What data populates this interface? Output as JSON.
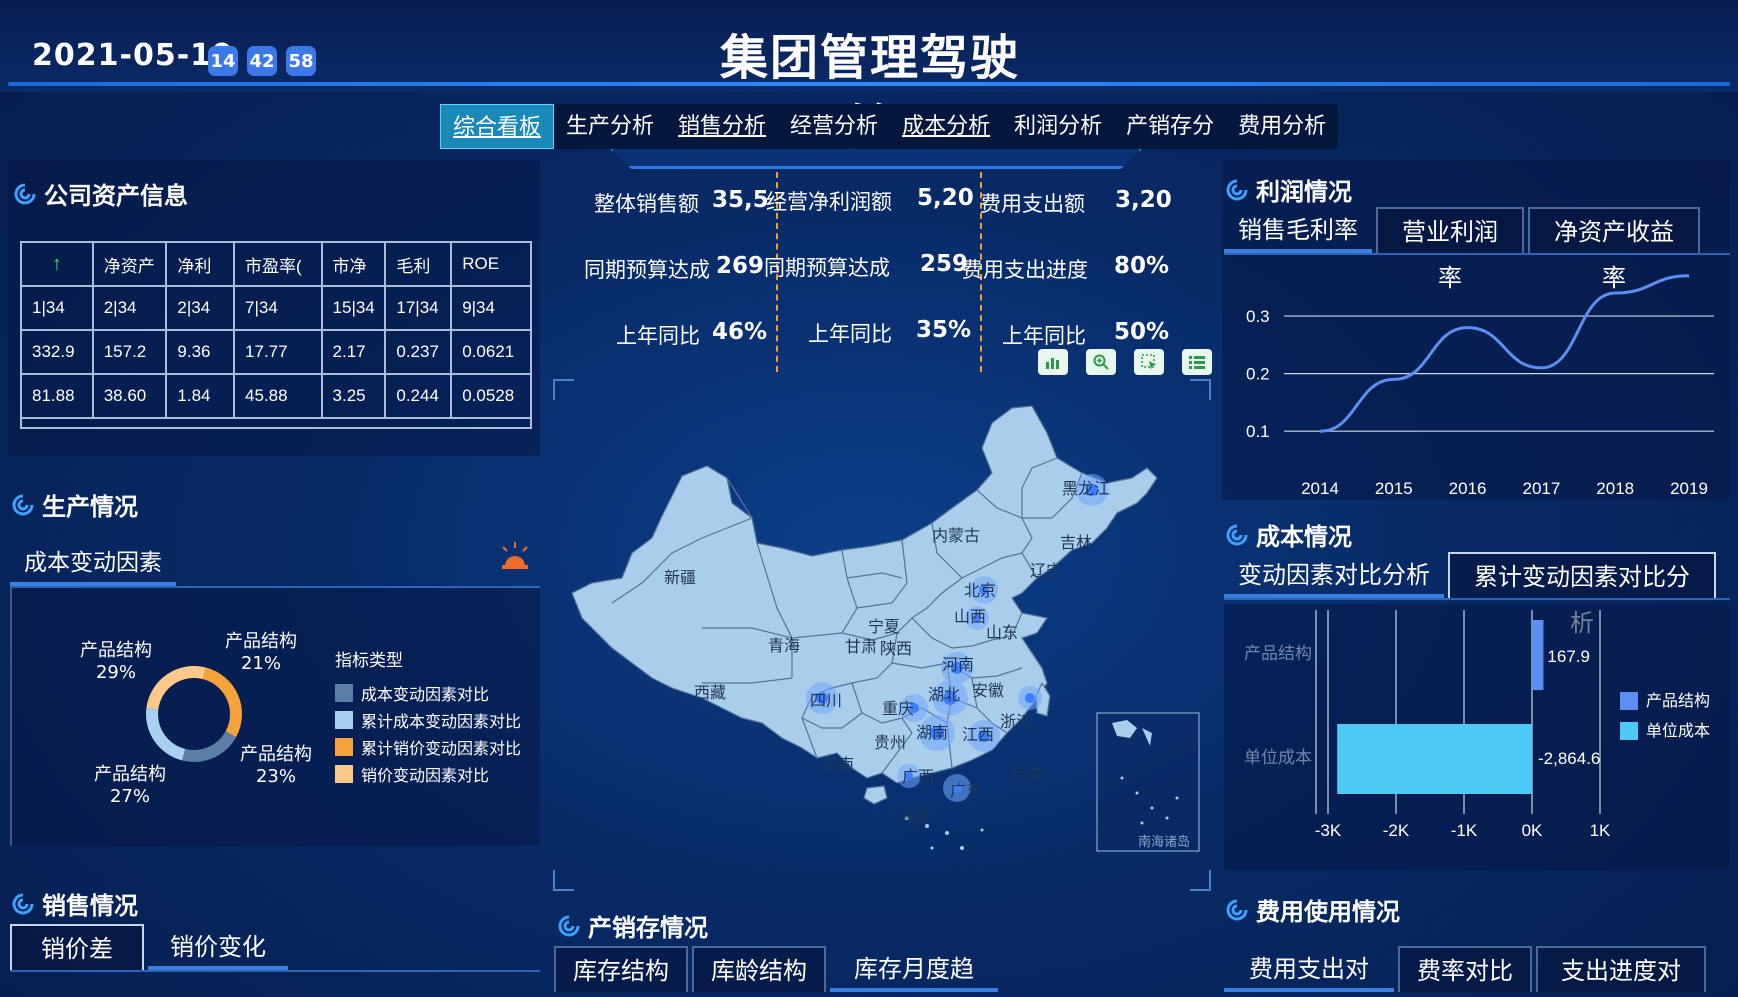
{
  "header": {
    "date": "2021-05-19",
    "time": [
      "14",
      "42",
      "58"
    ],
    "title": "集团管理驾驶舱"
  },
  "nav": {
    "tabs": [
      {
        "label": "综合看板",
        "active": true
      },
      {
        "label": "生产分析"
      },
      {
        "label": "销售分析"
      },
      {
        "label": "经营分析"
      },
      {
        "label": "成本分析"
      },
      {
        "label": "利润分析"
      },
      {
        "label": "产销存分"
      },
      {
        "label": "费用分析"
      }
    ]
  },
  "assets": {
    "title": "公司资产信息",
    "header_arrow": "↑",
    "columns": [
      "净资产",
      "净利",
      "市盈率(",
      "市净",
      "毛利",
      "ROE"
    ],
    "rows": [
      [
        "1|34",
        "2|34",
        "2|34",
        "7|34",
        "15|34",
        "17|34",
        "9|34"
      ],
      [
        "332.9",
        "157.2",
        "9.36",
        "17.77",
        "2.17",
        "0.237",
        "0.0621"
      ],
      [
        "81.88",
        "38.60",
        "1.84",
        "45.88",
        "3.25",
        "0.244",
        "0.0528"
      ]
    ]
  },
  "production": {
    "title": "生产情况",
    "tab": "成本变动因素",
    "donut_labels": [
      {
        "name": "产品结构",
        "pct": "29%"
      },
      {
        "name": "产品结构",
        "pct": "21%"
      },
      {
        "name": "产品结构",
        "pct": "23%"
      },
      {
        "name": "产品结构",
        "pct": "27%"
      }
    ],
    "legend_title": "指标类型",
    "legend": [
      {
        "label": "成本变动因素对比",
        "color": "#5a7ea6"
      },
      {
        "label": "累计成本变动因素对比",
        "color": "#a8d0f0"
      },
      {
        "label": "累计销价变动因素对比",
        "color": "#f5a23a"
      },
      {
        "label": "销价变动因素对比",
        "color": "#fcc98a"
      }
    ]
  },
  "sales": {
    "title": "销售情况",
    "tabs": [
      "销价差",
      "销价变化"
    ]
  },
  "kpi": {
    "row1": [
      {
        "label": "整体销售额",
        "value": "35,5"
      },
      {
        "label": "经营净利润额",
        "value": "5,20"
      },
      {
        "label": "费用支出额",
        "value": "3,20"
      }
    ],
    "row2": [
      {
        "label": "同期预算达成",
        "value": "269"
      },
      {
        "label": "同期预算达成",
        "value": "259"
      },
      {
        "label": "费用支出进度",
        "value": "80%"
      }
    ],
    "row3": [
      {
        "label": "上年同比",
        "value": "46%"
      },
      {
        "label": "上年同比",
        "value": "35%"
      },
      {
        "label": "上年同比",
        "value": "50%"
      }
    ]
  },
  "map": {
    "provinces": {
      "xinjiang": "新疆",
      "xizang": "西藏",
      "qinghai": "青海",
      "gansu": "甘肃",
      "neimenggu": "内蒙古",
      "heilongjiang": "黑龙江",
      "jilin": "吉林",
      "liaoning": "辽宁",
      "ningxia": "宁夏",
      "shaanxi": "陕西",
      "shandong": "山东",
      "sichuan": "四川",
      "chongqing": "重庆",
      "guizhou": "贵州",
      "yunnan": "云南",
      "guangxi": "广西",
      "anhui": "安徽",
      "zhejiang": "浙江",
      "taiwan": "台湾",
      "hainan": "海南",
      "hebei": "北京",
      "henan": "河南",
      "hubei": "湖北",
      "hunan": "湖南",
      "jiangxi": "江西",
      "guangdong": "广东",
      "shanxi": "山西"
    },
    "inset_label": "南海诸岛"
  },
  "inventory": {
    "title": "产销存情况",
    "tabs": [
      "库存结构",
      "库龄结构",
      "库存月度趋势"
    ]
  },
  "profit": {
    "title": "利润情况",
    "tabs": [
      "销售毛利率",
      "营业利润率",
      "净资产收益率"
    ]
  },
  "cost": {
    "title": "成本情况",
    "tabs": [
      "变动因素对比分析",
      "累计变动因素对比分析"
    ]
  },
  "expense": {
    "title": "费用使用情况",
    "tabs": [
      "费用支出对比",
      "费率对比",
      "支出进度对比"
    ]
  },
  "chart_data": [
    {
      "type": "line",
      "x": [
        "2014",
        "2015",
        "2016",
        "2017",
        "2018",
        "2019"
      ],
      "series": [
        {
          "values": [
            0.1,
            0.19,
            0.28,
            0.21,
            0.34,
            0.37
          ]
        }
      ],
      "yticks": [
        "0.1",
        "0.2",
        "0.3"
      ],
      "ylim": [
        0.05,
        0.38
      ],
      "grid": true,
      "color": "#5b8ff0"
    },
    {
      "type": "bar",
      "orientation": "horizontal",
      "categories": [
        "产品结构",
        "单位成本"
      ],
      "series": [
        {
          "name": "产品结构",
          "values": [
            167.9,
            0
          ],
          "color": "#5b8ff0"
        },
        {
          "name": "单位成本",
          "values": [
            0,
            -2864.6
          ],
          "color": "#4ec9f5"
        }
      ],
      "data_labels": [
        "167.9",
        "-2,864.6"
      ],
      "xticks": [
        "-3K",
        "-2K",
        "-1K",
        "0K",
        "1K"
      ],
      "xlim": [
        -3000,
        1000
      ],
      "legend": "right"
    },
    {
      "type": "pie",
      "values": [
        29,
        21,
        23,
        27
      ],
      "colors": [
        "#f5a23a",
        "#5a7ea6",
        "#a8d0f0",
        "#fcc98a"
      ]
    }
  ]
}
